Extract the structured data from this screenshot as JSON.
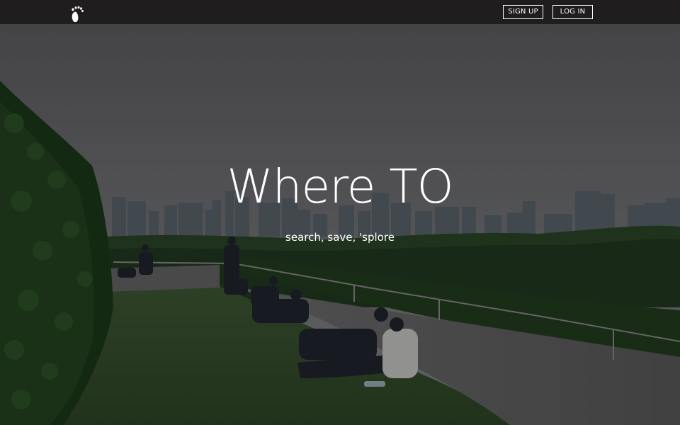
{
  "nav": {
    "logo_icon": "footprint-icon",
    "signup_label": "SIGN UP",
    "login_label": "LOG IN"
  },
  "hero": {
    "title": "Where TO",
    "subtitle": "search, save, 'splore",
    "background_image": "rooftop-garden-city-skyline"
  },
  "colors": {
    "navbar": "#1f1d1e",
    "text": "#ffffff",
    "overlay": "#000000"
  }
}
